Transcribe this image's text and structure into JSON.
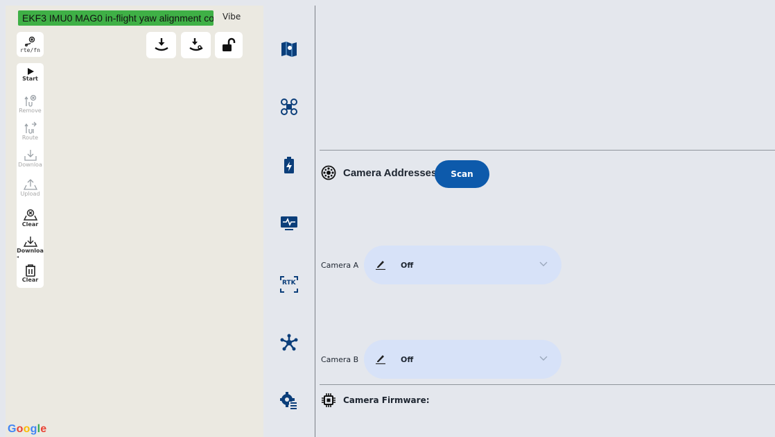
{
  "map": {
    "status_text": "EKF3 IMU0 MAG0 in-flight yaw alignment co",
    "vibe_label": "Vibe",
    "rte_fn_label": "rte/fn",
    "google_logo": "Google",
    "google_color": "#4285f4",
    "toolbar": [
      {
        "label": "Start",
        "icon": "play-icon",
        "state": "active"
      },
      {
        "label": "Remove",
        "icon": "remove-waypoint-icon",
        "state": "disabled"
      },
      {
        "label": "Route",
        "icon": "route-icon",
        "state": "disabled"
      },
      {
        "label": "Downloa",
        "icon": "download-icon",
        "state": "disabled"
      },
      {
        "label": "Upload",
        "icon": "upload-icon",
        "state": "disabled"
      },
      {
        "label": "Clear",
        "icon": "clear-mission-icon",
        "state": "active"
      },
      {
        "label": "Downloa",
        "icon": "download-mission-icon",
        "state": "active"
      },
      {
        "label": "Clear",
        "icon": "trash-icon",
        "state": "active"
      }
    ],
    "top_buttons": [
      "land-icon",
      "return-home-icon",
      "unlock-icon"
    ]
  },
  "sidebar": {
    "icons": [
      "map-icon",
      "drone-icon",
      "battery-icon",
      "monitor-icon",
      "rtk-icon",
      "network-icon",
      "settings-list-icon"
    ],
    "rtk_text": "RTK",
    "icon_color": "#0b3e7a"
  },
  "camera": {
    "addresses_title": "Camera Addresses",
    "scan_label": "Scan",
    "scan_color": "#0d5aab",
    "camera_a_label": "Camera A",
    "camera_a_value": "Off",
    "camera_b_label": "Camera B",
    "camera_b_value": "Off",
    "firmware_title": "Camera Firmware:"
  }
}
